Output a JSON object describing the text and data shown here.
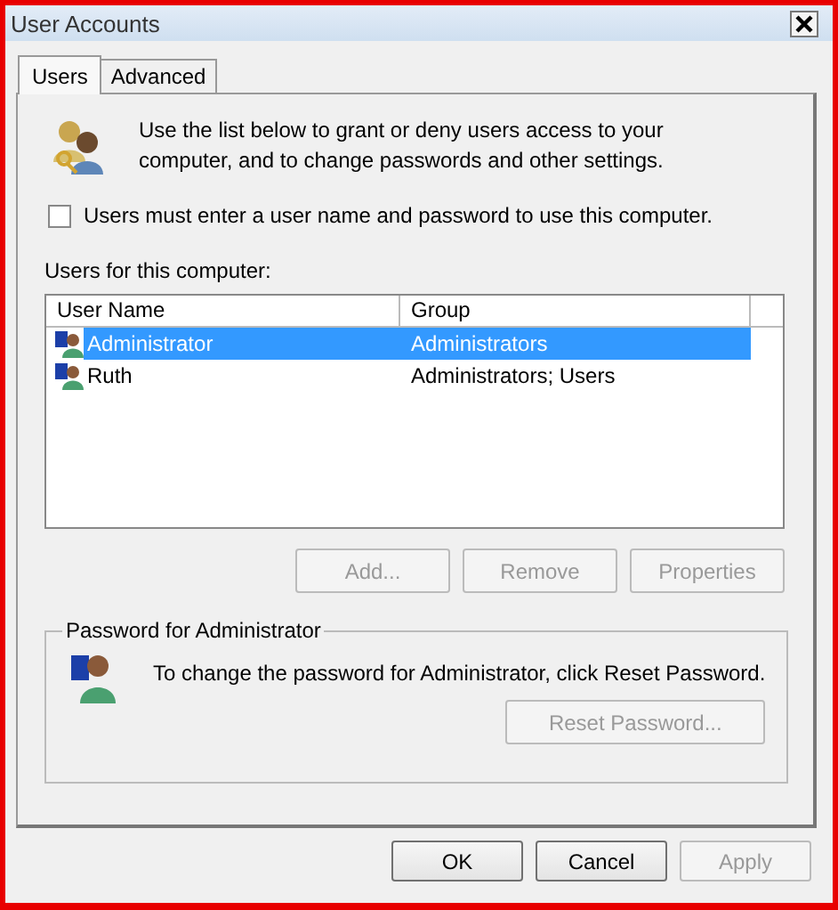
{
  "window": {
    "title": "User Accounts"
  },
  "tabs": [
    {
      "label": "Users",
      "selected": true
    },
    {
      "label": "Advanced",
      "selected": false
    }
  ],
  "intro": "Use the list below to grant or deny users access to your computer, and to change passwords and other settings.",
  "login_checkbox": {
    "label": "Users must enter a user name and password to use this computer.",
    "checked": false
  },
  "users_label": "Users for this computer:",
  "table": {
    "columns": [
      "User Name",
      "Group"
    ],
    "rows": [
      {
        "name": "Administrator",
        "group": "Administrators",
        "selected": true
      },
      {
        "name": "Ruth",
        "group": "Administrators; Users",
        "selected": false
      }
    ]
  },
  "list_buttons": [
    {
      "label": "Add...",
      "disabled": true
    },
    {
      "label": "Remove",
      "disabled": true
    },
    {
      "label": "Properties",
      "disabled": true
    }
  ],
  "password_group": {
    "title": "Password for Administrator",
    "text": "To change the password for Administrator, click Reset Password.",
    "button": {
      "label": "Reset Password...",
      "disabled": true
    }
  },
  "dialog_buttons": [
    {
      "label": "OK",
      "disabled": false
    },
    {
      "label": "Cancel",
      "disabled": false
    },
    {
      "label": "Apply",
      "disabled": true
    }
  ]
}
